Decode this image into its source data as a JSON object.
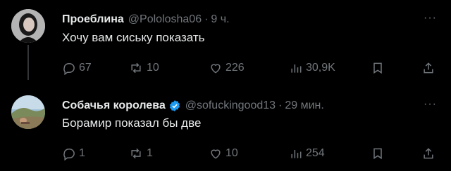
{
  "tweets": [
    {
      "author": "Проеблина",
      "handle": "@Pololosha06",
      "separator": "·",
      "time": "9 ч.",
      "more": "···",
      "text": "Хочу вам сиську показать",
      "reply_count": "67",
      "retweet_count": "10",
      "like_count": "226",
      "view_count": "30,9K"
    },
    {
      "author": "Собачья королева",
      "handle": "@sofuckingood13",
      "separator": "·",
      "time": "29 мин.",
      "more": "···",
      "text": "Борамир показал бы две",
      "reply_count": "1",
      "retweet_count": "1",
      "like_count": "10",
      "view_count": "254"
    }
  ],
  "colors": {
    "background": "#000000",
    "text": "#e7e9ea",
    "muted": "#71767b",
    "verified": "#1d9bf0"
  }
}
